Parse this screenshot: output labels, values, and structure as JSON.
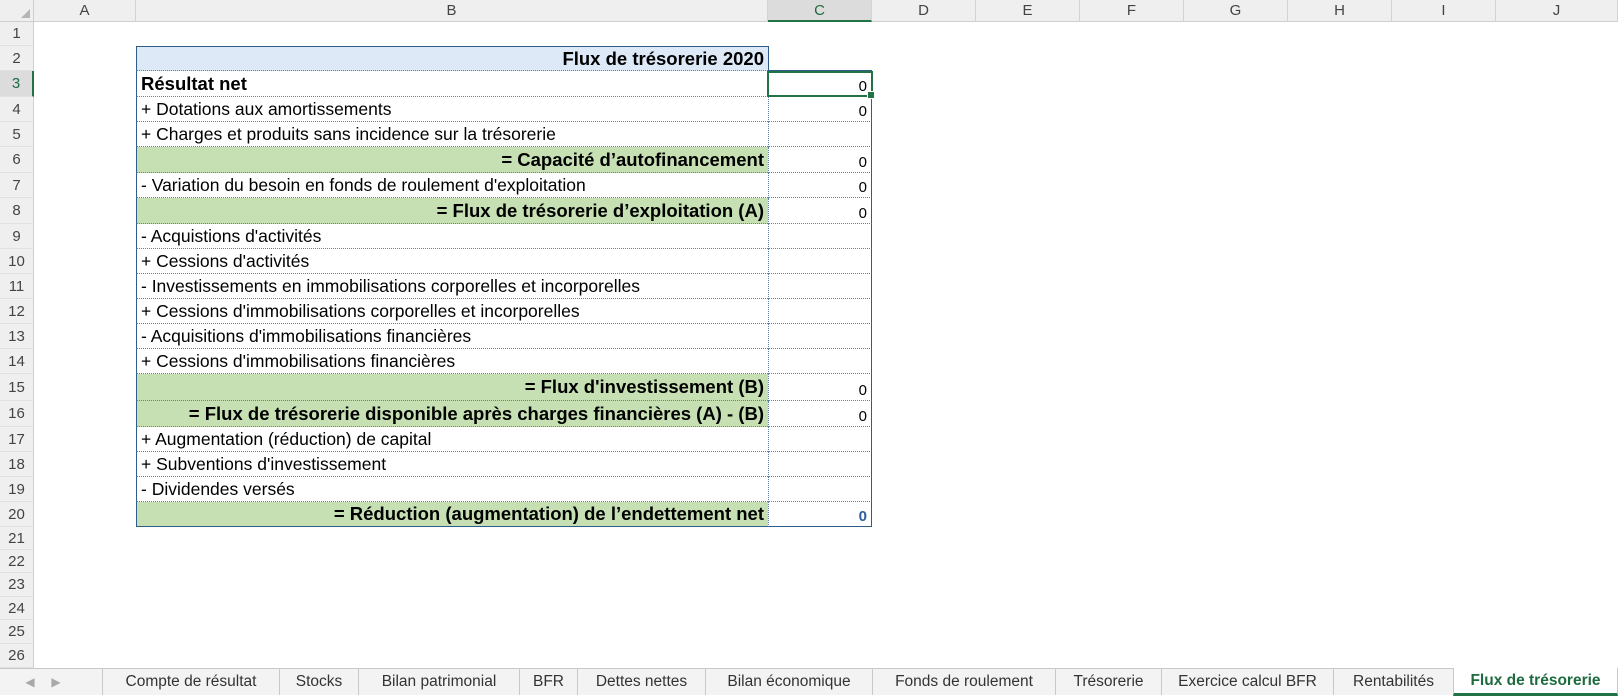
{
  "columns": [
    "A",
    "B",
    "C",
    "D",
    "E",
    "F",
    "G",
    "H",
    "I",
    "J"
  ],
  "rows": [
    "1",
    "2",
    "3",
    "4",
    "5",
    "6",
    "7",
    "8",
    "9",
    "10",
    "11",
    "12",
    "13",
    "14",
    "15",
    "16",
    "17",
    "18",
    "19",
    "20",
    "21",
    "22",
    "23",
    "24",
    "25",
    "26"
  ],
  "active_column": "C",
  "active_row": "3",
  "table": {
    "title": "Flux de trésorerie 2020",
    "lines": [
      {
        "label": "Résultat net",
        "value": "0"
      },
      {
        "label": "+ Dotations aux amortissements",
        "value": "0"
      },
      {
        "label": "+ Charges et produits sans incidence sur la trésorerie",
        "value": ""
      },
      {
        "label": "= Capacité d’autofinancement",
        "value": "0"
      },
      {
        "label": "- Variation du besoin en fonds de roulement d'exploitation",
        "value": "0"
      },
      {
        "label": "= Flux de trésorerie d’exploitation (A)",
        "value": "0"
      },
      {
        "label": "- Acquistions d'activités",
        "value": ""
      },
      {
        "label": "+ Cessions d'activités",
        "value": ""
      },
      {
        "label": "- Investissements en immobilisations corporelles et incorporelles",
        "value": ""
      },
      {
        "label": "+ Cessions d'immobilisations corporelles et incorporelles",
        "value": ""
      },
      {
        "label": "- Acquisitions d'immobilisations financières",
        "value": ""
      },
      {
        "label": "+ Cessions d'immobilisations financières",
        "value": ""
      },
      {
        "label": "= Flux d'investissement (B)",
        "value": "0"
      },
      {
        "label": "= Flux de trésorerie disponible après charges financières (A) - (B)",
        "value": "0"
      },
      {
        "label": "+ Augmentation (réduction) de capital",
        "value": ""
      },
      {
        "label": "+ Subventions d'investissement",
        "value": ""
      },
      {
        "label": "- Dividendes versés",
        "value": ""
      },
      {
        "label": "= Réduction (augmentation) de l’endettement net",
        "value": "0"
      }
    ]
  },
  "sheet_tabs": [
    "Compte de résultat",
    "Stocks",
    "Bilan patrimonial",
    "BFR",
    "Dettes nettes",
    "Bilan économique",
    "Fonds de roulement",
    "Trésorerie",
    "Exercice calcul BFR",
    "Rentabilités",
    "Flux de trésorerie"
  ],
  "active_tab": "Flux de trésorerie",
  "colors": {
    "accent": "#217346",
    "subtotal_fill": "#c6e0b4",
    "header_fill": "#dde9f7",
    "border": "#2f5d8a",
    "final_value": "#2f5d9a"
  }
}
